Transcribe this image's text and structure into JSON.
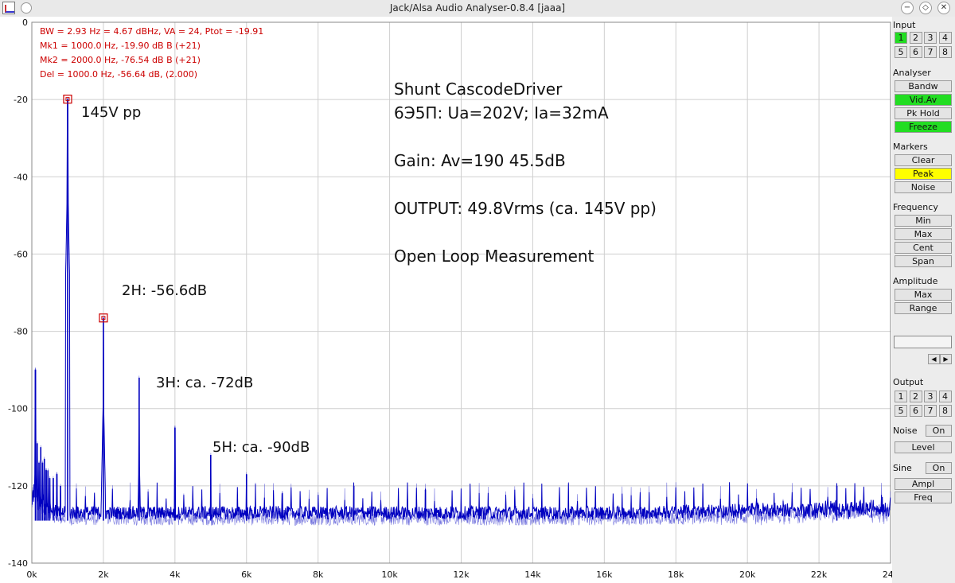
{
  "window": {
    "title": "Jack/Alsa Audio Analyser-0.8.4  [jaaa]",
    "buttons": [
      "−",
      "◇",
      "✕"
    ]
  },
  "info": {
    "line1": "BW = 2.93 Hz =  4.67 dBHz, VA = 24, Ptot = -19.91",
    "line2": "Mk1 =   1000.0 Hz,  -19.90 dB      B (+21)",
    "line3": "Mk2 =   2000.0 Hz,  -76.54 dB      B (+21)",
    "line4": "Del =   1000.0 Hz,  -56.64 dB, (2.000)"
  },
  "annotations": {
    "title_line1": "Shunt CascodeDriver",
    "title_line2": "6Э5П: Ua=202V; Ia=32mA",
    "gain": "Gain: Av=190  45.5dB",
    "output": "OUTPUT: 49.8Vrms (ca. 145V pp)",
    "mode": "Open Loop Measurement",
    "fundamental": "145V pp",
    "h2": "2H: -56.6dB",
    "h3": "3H: ca. -72dB",
    "h5": "5H: ca. -90dB"
  },
  "colors": {
    "trace": "#0000c0",
    "hold_trace": "#3a3ad0",
    "grid": "#cfcfcf",
    "info_text": "#cc0000",
    "marker": "#cc0000"
  },
  "sidebar": {
    "input": {
      "label": "Input",
      "channels": [
        "1",
        "2",
        "3",
        "4",
        "5",
        "6",
        "7",
        "8"
      ],
      "active": "1"
    },
    "analyser": {
      "label": "Analyser",
      "buttons": [
        {
          "label": "Bandw",
          "state": "off"
        },
        {
          "label": "Vid.Av",
          "state": "on"
        },
        {
          "label": "Pk Hold",
          "state": "off"
        },
        {
          "label": "Freeze",
          "state": "on"
        }
      ]
    },
    "markers": {
      "label": "Markers",
      "buttons": [
        {
          "label": "Clear",
          "state": "off"
        },
        {
          "label": "Peak",
          "state": "active"
        },
        {
          "label": "Noise",
          "state": "off"
        }
      ]
    },
    "frequency": {
      "label": "Frequency",
      "buttons": [
        "Min",
        "Max",
        "Cent",
        "Span"
      ]
    },
    "amplitude": {
      "label": "Amplitude",
      "buttons": [
        "Max",
        "Range"
      ]
    },
    "value_field": "",
    "arrows": [
      "◀",
      "▶"
    ],
    "output": {
      "label": "Output",
      "channels": [
        "1",
        "2",
        "3",
        "4",
        "5",
        "6",
        "7",
        "8"
      ]
    },
    "noise": {
      "label": "Noise",
      "toggle": "On",
      "button": "Level"
    },
    "sine": {
      "label": "Sine",
      "toggle": "On",
      "buttons": [
        "Ampl",
        "Freq"
      ]
    }
  },
  "chart_data": {
    "type": "line",
    "xlabel": "",
    "ylabel": "",
    "xlim": [
      0,
      24000
    ],
    "ylim": [
      -140,
      0
    ],
    "x_ticks": [
      0,
      2000,
      4000,
      6000,
      8000,
      10000,
      12000,
      14000,
      16000,
      18000,
      20000,
      22000,
      24000
    ],
    "x_tick_labels": [
      "0k",
      "2k",
      "4k",
      "6k",
      "8k",
      "10k",
      "12k",
      "14k",
      "16k",
      "18k",
      "20k",
      "22k",
      "24k"
    ],
    "y_ticks": [
      0,
      -20,
      -40,
      -60,
      -80,
      -100,
      -120,
      -140
    ],
    "y_tick_labels": [
      "0",
      "-20",
      "-40",
      "-60",
      "-80",
      "-100",
      "-120",
      "-140"
    ],
    "grid": true,
    "noise_floor_db": -127,
    "peaks": [
      {
        "freq": 1000,
        "db": -20
      },
      {
        "freq": 2000,
        "db": -76.5
      },
      {
        "freq": 3000,
        "db": -92
      },
      {
        "freq": 4000,
        "db": -105
      },
      {
        "freq": 5000,
        "db": -112
      },
      {
        "freq": 6000,
        "db": -117
      },
      {
        "freq": 7000,
        "db": -122
      },
      {
        "freq": 9000,
        "db": -120
      },
      {
        "freq": 11000,
        "db": -121
      },
      {
        "freq": 22500,
        "db": -120
      }
    ],
    "low_freq_peaks": [
      {
        "freq": 100,
        "db": -90
      },
      {
        "freq": 150,
        "db": -109
      },
      {
        "freq": 200,
        "db": -114
      },
      {
        "freq": 250,
        "db": -110
      },
      {
        "freq": 300,
        "db": -114
      },
      {
        "freq": 350,
        "db": -113
      },
      {
        "freq": 400,
        "db": -116
      },
      {
        "freq": 450,
        "db": -116
      },
      {
        "freq": 500,
        "db": -118
      },
      {
        "freq": 600,
        "db": -118
      },
      {
        "freq": 700,
        "db": -117
      },
      {
        "freq": 800,
        "db": -120
      }
    ],
    "markers": [
      {
        "name": "Mk1",
        "freq": 1000,
        "db": -19.9
      },
      {
        "name": "Mk2",
        "freq": 2000,
        "db": -76.54
      }
    ]
  }
}
